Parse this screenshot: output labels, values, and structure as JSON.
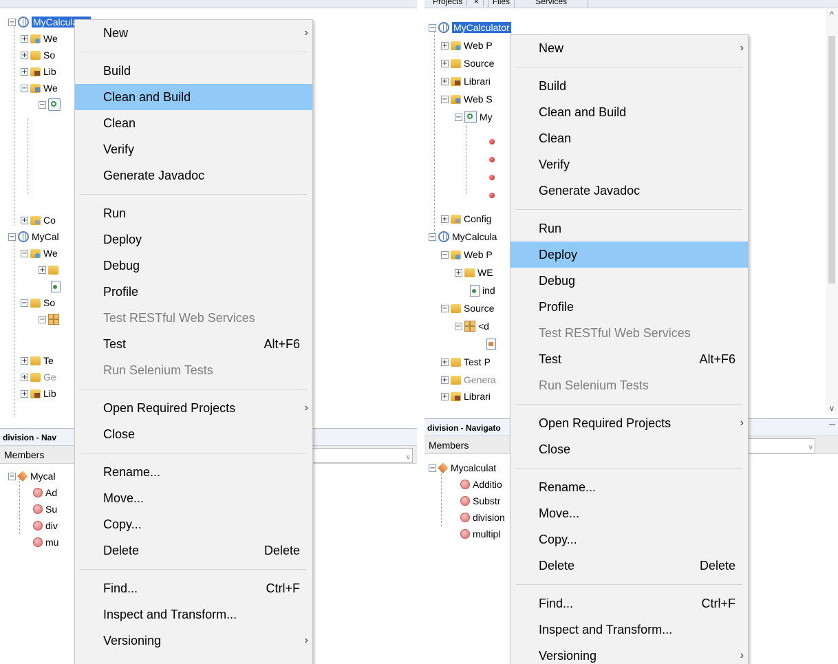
{
  "tabs": [
    "Projects",
    "×",
    "Files",
    "Services"
  ],
  "left": {
    "tree": [
      {
        "label": "MyCalculator",
        "selected": true
      },
      {
        "label": "We"
      },
      {
        "label": "So"
      },
      {
        "label": "Lib"
      },
      {
        "label": "We"
      },
      {
        "label": "Co"
      },
      {
        "label": "MyCal"
      },
      {
        "label": "We"
      },
      {
        "label": "So"
      },
      {
        "label": "Te"
      },
      {
        "label": "Ge"
      },
      {
        "label": "Lib"
      }
    ],
    "navigator_title": "division - Nav",
    "members_label": "Members",
    "members": [
      "Mycal",
      "Ad",
      "Su",
      "div",
      "mu"
    ],
    "menu": {
      "new": "New",
      "build": "Build",
      "clean_build": "Clean and Build",
      "clean": "Clean",
      "verify": "Verify",
      "javadoc": "Generate Javadoc",
      "run": "Run",
      "deploy": "Deploy",
      "debug": "Debug",
      "profile": "Profile",
      "test_rest": "Test RESTful Web Services",
      "test": "Test",
      "test_sc": "Alt+F6",
      "selenium": "Run Selenium Tests",
      "open_req": "Open Required Projects",
      "close": "Close",
      "rename": "Rename...",
      "move": "Move...",
      "copy": "Copy...",
      "delete": "Delete",
      "delete_sc": "Delete",
      "find": "Find...",
      "find_sc": "Ctrl+F",
      "inspect": "Inspect and Transform...",
      "versioning": "Versioning"
    }
  },
  "right": {
    "tree": [
      {
        "label": "MyCalculator",
        "selected": true
      },
      {
        "label": "Web P"
      },
      {
        "label": "Source"
      },
      {
        "label": "Librari"
      },
      {
        "label": "Web S"
      },
      {
        "label": "My"
      },
      {
        "label": "Config"
      },
      {
        "label": "MyCalcula"
      },
      {
        "label": "Web P"
      },
      {
        "label": "WE"
      },
      {
        "label": "ind"
      },
      {
        "label": "Source"
      },
      {
        "label": "<d"
      },
      {
        "label": "Test P"
      },
      {
        "label": "Genera"
      },
      {
        "label": "Librari"
      }
    ],
    "navigator_title": "division - Navigato",
    "members_label": "Members",
    "members": [
      "Mycalculat",
      "Additio",
      "Substr",
      "division",
      "multipl"
    ],
    "menu": {
      "new": "New",
      "build": "Build",
      "clean_build": "Clean and Build",
      "clean": "Clean",
      "verify": "Verify",
      "javadoc": "Generate Javadoc",
      "run": "Run",
      "deploy": "Deploy",
      "debug": "Debug",
      "profile": "Profile",
      "test_rest": "Test RESTful Web Services",
      "test": "Test",
      "test_sc": "Alt+F6",
      "selenium": "Run Selenium Tests",
      "open_req": "Open Required Projects",
      "close": "Close",
      "rename": "Rename...",
      "move": "Move...",
      "copy": "Copy...",
      "delete": "Delete",
      "delete_sc": "Delete",
      "find": "Find...",
      "find_sc": "Ctrl+F",
      "inspect": "Inspect and Transform...",
      "versioning": "Versioning"
    }
  },
  "colors": {
    "menu_highlight": "#91c9f7",
    "tree_selection": "#2b6fd6",
    "menu_background": "#f2f2f2"
  }
}
